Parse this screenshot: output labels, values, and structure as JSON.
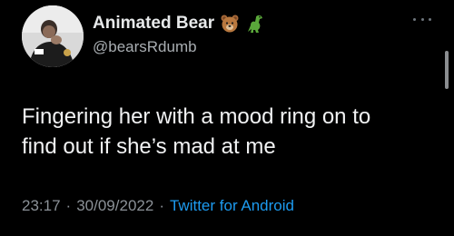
{
  "author": {
    "display_name": "Animated Bear",
    "handle": "@bearsRdumb",
    "name_emojis": [
      "bear-face-icon",
      "dinosaur-icon"
    ]
  },
  "tweet": {
    "text": "Fingering her with a mood ring on to\nfind out if she’s mad at me",
    "time": "23:17",
    "date": "30/09/2022",
    "separator": "·",
    "source": "Twitter for Android"
  },
  "colors": {
    "background": "#000000",
    "text_primary": "#e7e9ea",
    "text_secondary": "#8b9197",
    "link": "#1d9bf0"
  }
}
